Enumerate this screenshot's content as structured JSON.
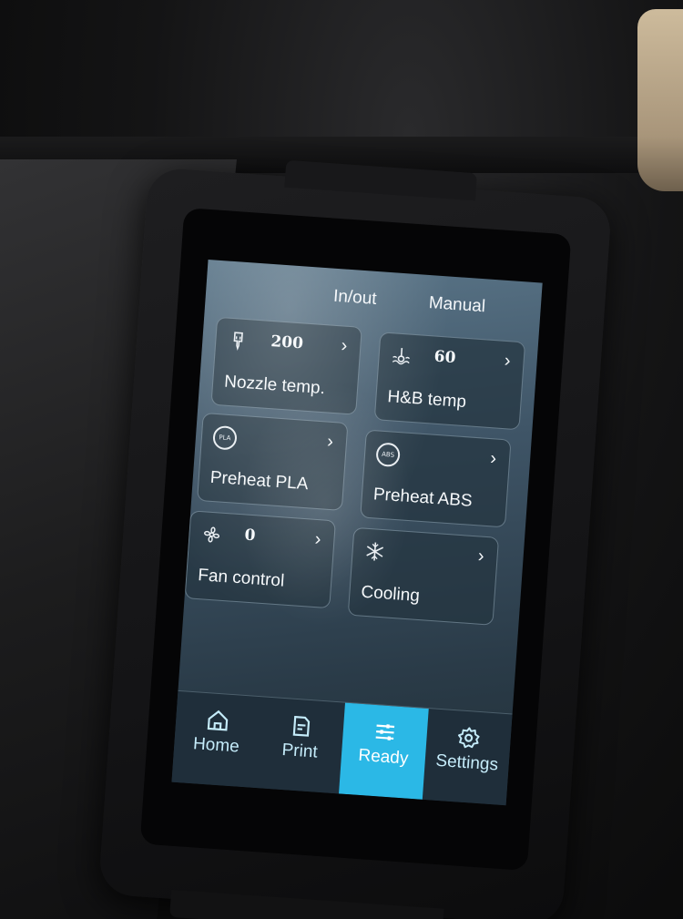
{
  "top_bar": {
    "inout_label": "In/out",
    "manual_label": "Manual"
  },
  "cards": [
    {
      "id": "nozzle",
      "icon": "nozzle-icon",
      "value": "200",
      "label": "Nozzle temp."
    },
    {
      "id": "bed",
      "icon": "heated-bed-icon",
      "value": "60",
      "label": "H&B temp"
    },
    {
      "id": "pla",
      "icon": "pla-icon",
      "badge": "PLA",
      "label": "Preheat PLA"
    },
    {
      "id": "abs",
      "icon": "abs-icon",
      "badge": "ABS",
      "label": "Preheat ABS"
    },
    {
      "id": "fan",
      "icon": "fan-icon",
      "value": "0",
      "label": "Fan control"
    },
    {
      "id": "cooling",
      "icon": "snowflake-icon",
      "label": "Cooling"
    }
  ],
  "chevron": "›",
  "nav": {
    "items": [
      {
        "label": "Home",
        "icon": "home-icon"
      },
      {
        "label": "Print",
        "icon": "file-icon"
      },
      {
        "label": "Ready",
        "icon": "sliders-icon"
      },
      {
        "label": "Settings",
        "icon": "gear-icon"
      }
    ],
    "active": "Ready"
  },
  "colors": {
    "accent": "#2bb8e6",
    "screen_bg": "#3f5567",
    "nav_text": "#c5ecfa"
  }
}
